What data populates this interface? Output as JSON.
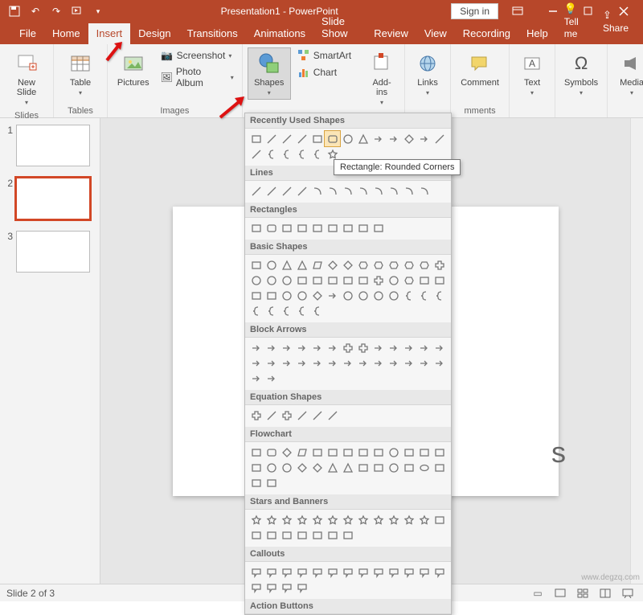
{
  "title": "Presentation1 - PowerPoint",
  "signin": "Sign in",
  "tabs": [
    "File",
    "Home",
    "Insert",
    "Design",
    "Transitions",
    "Animations",
    "Slide Show",
    "Review",
    "View",
    "Recording",
    "Help"
  ],
  "active_tab": "Insert",
  "tellme": "Tell me",
  "share": "Share",
  "ribbon": {
    "slides": {
      "new_slide": "New\nSlide",
      "label": "Slides"
    },
    "tables": {
      "table": "Table",
      "label": "Tables"
    },
    "images": {
      "pictures": "Pictures",
      "screenshot": "Screenshot",
      "photo_album": "Photo Album",
      "label": "Images"
    },
    "illustrations": {
      "shapes": "Shapes",
      "smartart": "SmartArt",
      "chart": "Chart"
    },
    "addins": {
      "addins": "Add-\nins"
    },
    "links": {
      "links": "Links"
    },
    "comments": {
      "comment": "Comment",
      "label": "mments"
    },
    "text": {
      "text": "Text"
    },
    "symbols": {
      "symbols": "Symbols"
    },
    "media": {
      "media": "Media"
    }
  },
  "shapes_dd": {
    "recent": "Recently Used Shapes",
    "lines": "Lines",
    "rectangles": "Rectangles",
    "basic": "Basic Shapes",
    "block": "Block Arrows",
    "equation": "Equation Shapes",
    "flow": "Flowchart",
    "stars": "Stars and Banners",
    "callouts": "Callouts",
    "action": "Action Buttons"
  },
  "tooltip": "Rectangle: Rounded Corners",
  "slide_text": "s",
  "thumbnails": [
    1,
    2,
    3
  ],
  "selected_thumb": 2,
  "status_text": "Slide 2 of 3",
  "watermark": "www.degzq.com"
}
